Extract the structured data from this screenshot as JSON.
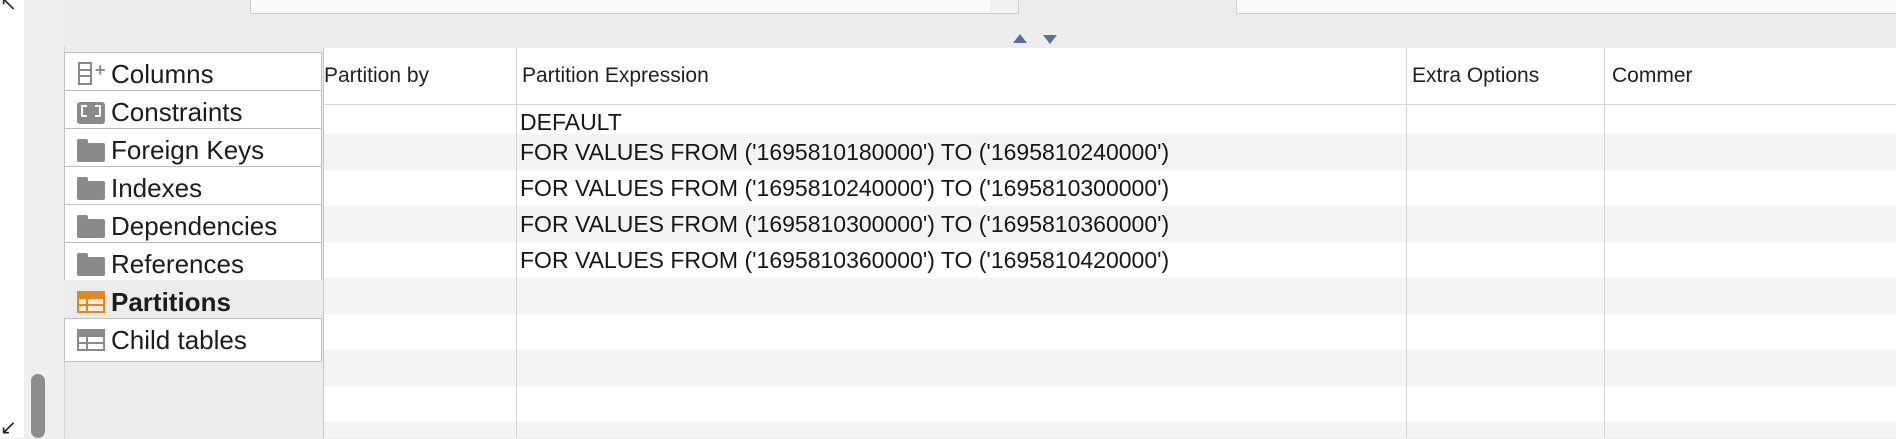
{
  "window": {
    "corner_top_glyph": "↖",
    "corner_bottom_glyph": "↙"
  },
  "side_tabs": [
    {
      "label": "Columns",
      "icon": "columns-icon",
      "selected": false
    },
    {
      "label": "Constraints",
      "icon": "constraints-icon",
      "selected": false
    },
    {
      "label": "Foreign Keys",
      "icon": "folder-icon",
      "selected": false
    },
    {
      "label": "Indexes",
      "icon": "folder-icon",
      "selected": false
    },
    {
      "label": "Dependencies",
      "icon": "folder-icon",
      "selected": false
    },
    {
      "label": "References",
      "icon": "folder-icon",
      "selected": false
    },
    {
      "label": "Partitions",
      "icon": "partitions-icon",
      "selected": true
    },
    {
      "label": "Child tables",
      "icon": "table-icon",
      "selected": false
    }
  ],
  "grid": {
    "headers": [
      "Partition by",
      "Partition Expression",
      "Extra Options",
      "Commer"
    ],
    "rows": [
      {
        "partition_by": "",
        "expression": "DEFAULT",
        "extra": "",
        "comment": ""
      },
      {
        "partition_by": "",
        "expression": "FOR VALUES FROM ('1695810180000') TO ('1695810240000')",
        "extra": "",
        "comment": ""
      },
      {
        "partition_by": "",
        "expression": "FOR VALUES FROM ('1695810240000') TO ('1695810300000')",
        "extra": "",
        "comment": ""
      },
      {
        "partition_by": "",
        "expression": "FOR VALUES FROM ('1695810300000') TO ('1695810360000')",
        "extra": "",
        "comment": ""
      },
      {
        "partition_by": "",
        "expression": "FOR VALUES FROM ('1695810360000') TO ('1695810420000')",
        "extra": "",
        "comment": ""
      },
      {
        "partition_by": "",
        "expression": "",
        "extra": "",
        "comment": ""
      },
      {
        "partition_by": "",
        "expression": "",
        "extra": "",
        "comment": ""
      },
      {
        "partition_by": "",
        "expression": "",
        "extra": "",
        "comment": ""
      },
      {
        "partition_by": "",
        "expression": "",
        "extra": "",
        "comment": ""
      }
    ]
  },
  "colors": {
    "selected_tab_icon": "#e8861e",
    "splitter_arrow": "#5b6f96"
  }
}
